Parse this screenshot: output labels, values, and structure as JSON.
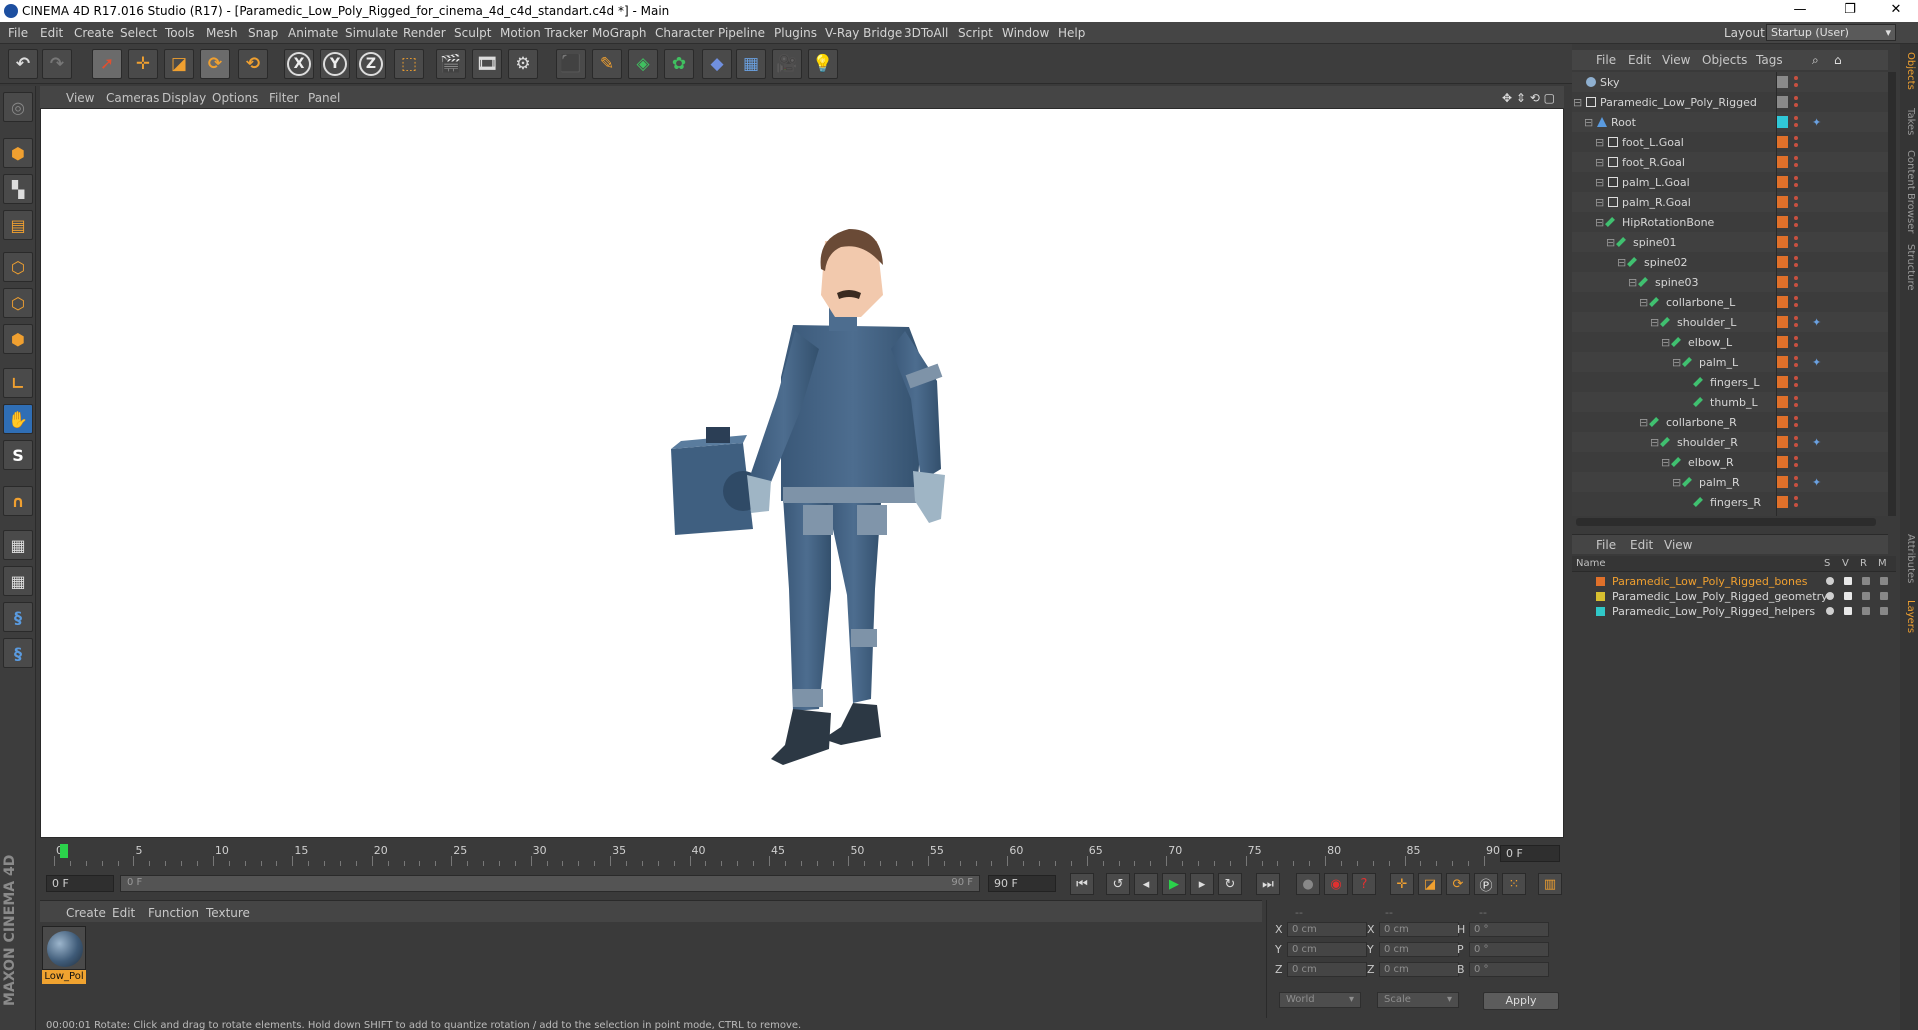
{
  "window": {
    "title": "CINEMA 4D R17.016 Studio (R17) - [Paramedic_Low_Poly_Rigged_for_cinema_4d_c4d_standart.c4d *] - Main",
    "minimize": "—",
    "restore": "❐",
    "close": "✕"
  },
  "menubar": {
    "items": [
      "File",
      "Edit",
      "Create",
      "Select",
      "Tools",
      "Mesh",
      "Snap",
      "Animate",
      "Simulate",
      "Render",
      "Sculpt",
      "Motion Tracker",
      "MoGraph",
      "Character",
      "Pipeline",
      "Plugins",
      "V-Ray Bridge",
      "3DToAll",
      "Script",
      "Window",
      "Help"
    ],
    "layout_label": "Layout:",
    "layout_value": "Startup (User)"
  },
  "toolbar": {
    "undo": "↶",
    "redo": "↷",
    "axis_x": "X",
    "axis_y": "Y",
    "axis_z": "Z"
  },
  "viewport": {
    "menu": [
      "View",
      "Cameras",
      "Display",
      "Options",
      "Filter",
      "Panel"
    ],
    "nav_icons": "✥ ⇕ ⟲ ▢"
  },
  "timeline": {
    "ticks": [
      0,
      5,
      10,
      15,
      20,
      25,
      30,
      35,
      40,
      45,
      50,
      55,
      60,
      65,
      70,
      75,
      80,
      85,
      90
    ],
    "current_frame": "0 F",
    "start_field": "0 F",
    "range_start": "0 F",
    "range_end": "90 F",
    "end_field": "90 F"
  },
  "material_manager": {
    "menu": [
      "Create",
      "Edit",
      "Function",
      "Texture"
    ],
    "material_name": "Low_Pol"
  },
  "coordinates": {
    "header": [
      "--",
      "--",
      "--"
    ],
    "rows": [
      {
        "l1": "X",
        "v1": "0 cm",
        "l2": "X",
        "v2": "0 cm",
        "l3": "H",
        "v3": "0 °"
      },
      {
        "l1": "Y",
        "v1": "0 cm",
        "l2": "Y",
        "v2": "0 cm",
        "l3": "P",
        "v3": "0 °"
      },
      {
        "l1": "Z",
        "v1": "0 cm",
        "l2": "Z",
        "v2": "0 cm",
        "l3": "B",
        "v3": "0 °"
      }
    ],
    "mode": "World",
    "scale": "Scale",
    "apply": "Apply"
  },
  "status": "00:00:01 Rotate: Click and drag to rotate elements. Hold down SHIFT to add to quantize rotation / add to the selection in point mode, CTRL to remove.",
  "object_manager": {
    "menu": [
      "File",
      "Edit",
      "View",
      "Objects",
      "Tags"
    ],
    "objects": [
      {
        "name": "Sky",
        "depth": 0,
        "type": "sky",
        "tag": "gray"
      },
      {
        "name": "Paramedic_Low_Poly_Rigged",
        "depth": 0,
        "type": "null",
        "tag": "gray"
      },
      {
        "name": "Root",
        "depth": 1,
        "type": "joint",
        "tag": "cyan",
        "extra": true
      },
      {
        "name": "foot_L.Goal",
        "depth": 2,
        "type": "null",
        "tag": "orange"
      },
      {
        "name": "foot_R.Goal",
        "depth": 2,
        "type": "null",
        "tag": "orange"
      },
      {
        "name": "palm_L.Goal",
        "depth": 2,
        "type": "null",
        "tag": "orange"
      },
      {
        "name": "palm_R.Goal",
        "depth": 2,
        "type": "null",
        "tag": "orange"
      },
      {
        "name": "HipRotationBone",
        "depth": 2,
        "type": "bone",
        "tag": "orange"
      },
      {
        "name": "spine01",
        "depth": 3,
        "type": "bone",
        "tag": "orange"
      },
      {
        "name": "spine02",
        "depth": 4,
        "type": "bone",
        "tag": "orange"
      },
      {
        "name": "spine03",
        "depth": 5,
        "type": "bone",
        "tag": "orange"
      },
      {
        "name": "collarbone_L",
        "depth": 6,
        "type": "bone",
        "tag": "orange"
      },
      {
        "name": "shoulder_L",
        "depth": 7,
        "type": "bone",
        "tag": "orange",
        "extra": true
      },
      {
        "name": "elbow_L",
        "depth": 8,
        "type": "bone",
        "tag": "orange"
      },
      {
        "name": "palm_L",
        "depth": 9,
        "type": "bone",
        "tag": "orange",
        "extra": true
      },
      {
        "name": "fingers_L",
        "depth": 10,
        "type": "bone",
        "tag": "orange"
      },
      {
        "name": "thumb_L",
        "depth": 10,
        "type": "bone",
        "tag": "orange"
      },
      {
        "name": "collarbone_R",
        "depth": 6,
        "type": "bone",
        "tag": "orange"
      },
      {
        "name": "shoulder_R",
        "depth": 7,
        "type": "bone",
        "tag": "orange",
        "extra": true
      },
      {
        "name": "elbow_R",
        "depth": 8,
        "type": "bone",
        "tag": "orange"
      },
      {
        "name": "palm_R",
        "depth": 9,
        "type": "bone",
        "tag": "orange",
        "extra": true
      },
      {
        "name": "fingers_R",
        "depth": 10,
        "type": "bone",
        "tag": "orange"
      }
    ]
  },
  "layer_manager": {
    "menu": [
      "File",
      "Edit",
      "View"
    ],
    "columns": {
      "name": "Name",
      "s": "S",
      "v": "V",
      "r": "R",
      "m": "M"
    },
    "layers": [
      {
        "name": "Paramedic_Low_Poly_Rigged_bones",
        "color": "#e0702a",
        "selected": true
      },
      {
        "name": "Paramedic_Low_Poly_Rigged_geometry",
        "color": "#d8c030"
      },
      {
        "name": "Paramedic_Low_Poly_Rigged_helpers",
        "color": "#30c8c8"
      }
    ]
  },
  "right_tabs": [
    "Objects",
    "Takes",
    "Content Browser",
    "Structure",
    "Attributes",
    "Layers"
  ],
  "left_tools": [
    "S"
  ],
  "brand": "MAXON CINEMA 4D",
  "colors": {
    "accent": "#f0a030",
    "playhead": "#2bd24b",
    "tag_orange": "#e0702a",
    "tag_cyan": "#30c8d8"
  }
}
